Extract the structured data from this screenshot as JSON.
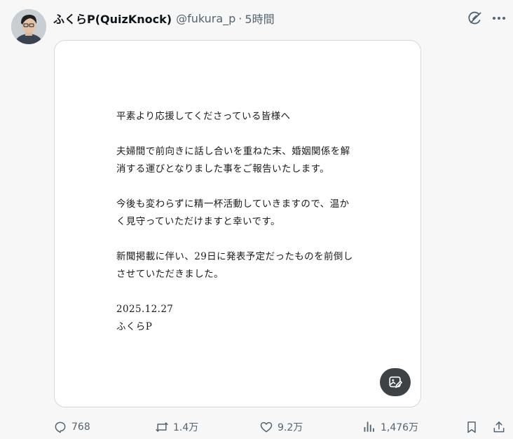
{
  "author": {
    "display_name": "ふくらP(QuizKnock)",
    "handle": "@fukura_p",
    "separator": "·",
    "time": "5時間"
  },
  "post": {
    "letter_lines": [
      "平素より応援してくださっている皆様へ",
      "",
      "夫婦間で前向きに話し合いを重ねた末、婚姻関係を解",
      "消する運びとなりました事をご報告いたします。",
      "",
      "今後も変わらずに精一杯活動していきますので、温か",
      "く見守っていただけますと幸いです。",
      "",
      "新聞掲載に伴い、29日に発表予定だったものを前倒し",
      "させていただきました。",
      "",
      "2025.12.27",
      "ふくらP"
    ]
  },
  "stats": {
    "replies": "768",
    "reposts": "1.4万",
    "likes": "9.2万",
    "views": "1,476万"
  },
  "icons": {
    "grok": "grok-icon",
    "more": "more-icon",
    "edit_image": "image-edit-icon",
    "reply": "reply-icon",
    "repost": "repost-icon",
    "like": "heart-icon",
    "views": "views-icon",
    "bookmark": "bookmark-icon",
    "share": "share-icon"
  },
  "colors": {
    "background": "#f7f7f7",
    "text_primary": "#0f1419",
    "text_secondary": "#536471",
    "card_border": "#cfd9de",
    "edit_button": "#3d4246"
  }
}
